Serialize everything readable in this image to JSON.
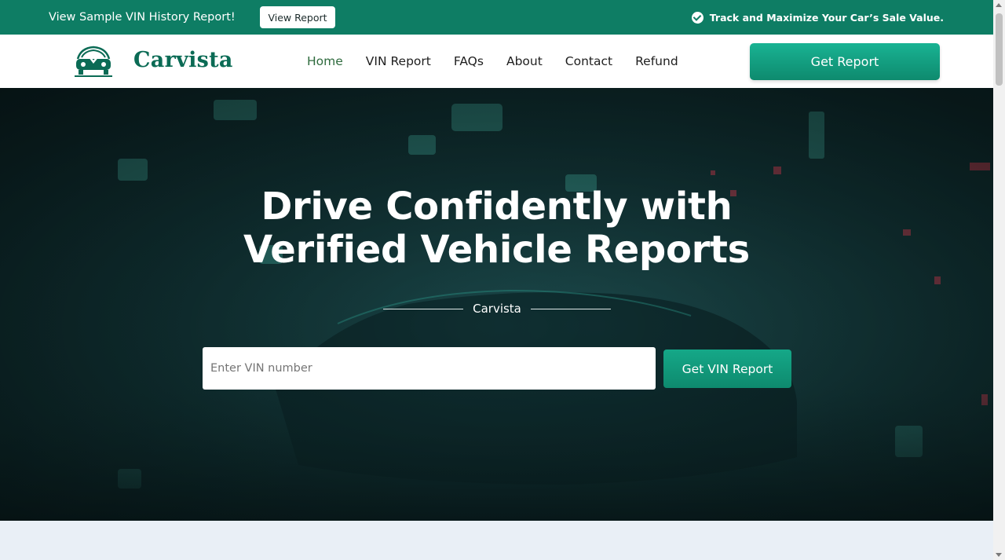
{
  "topbar": {
    "promo_text": "View Sample VIN History Report!",
    "promo_button": "View Report",
    "right_text": "Track and Maximize Your Car’s Sale Value.",
    "right_icon": "check-circle-icon",
    "background": "#0e7d64"
  },
  "header": {
    "logo_text": "Carvista",
    "nav": [
      {
        "label": "Home",
        "active": true
      },
      {
        "label": "VIN Report",
        "active": false
      },
      {
        "label": "FAQs",
        "active": false
      },
      {
        "label": "About",
        "active": false
      },
      {
        "label": "Contact",
        "active": false
      },
      {
        "label": "Refund",
        "active": false
      }
    ],
    "cta_button": "Get Report"
  },
  "hero": {
    "title_line1": "Drive Confidently with",
    "title_line2": "Verified Vehicle Reports",
    "divider_label": "Carvista",
    "vin_placeholder": "Enter VIN number",
    "vin_value": "",
    "vin_button": "Get VIN Report"
  },
  "colors": {
    "brand_green": "#0e7d64",
    "button_green": "#15a888",
    "logo_green": "#0b6b55",
    "hero_dark": "#123638"
  }
}
